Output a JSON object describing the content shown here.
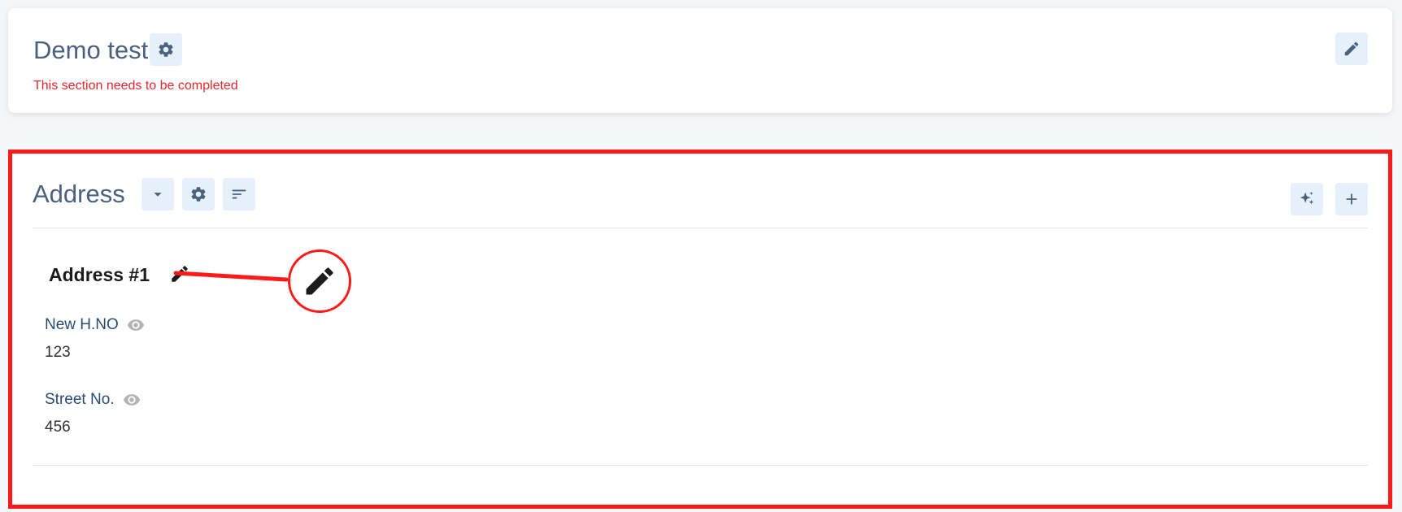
{
  "top_card": {
    "title": "Demo test",
    "message": "This section needs to be completed",
    "icons": {
      "settings": "gear-icon",
      "edit": "pencil-icon"
    }
  },
  "address_section": {
    "title": "Address",
    "header_icons": [
      "caret-down-icon",
      "gear-icon",
      "sort-icon"
    ],
    "right_icons": [
      "sparkles-icon",
      "plus-icon"
    ],
    "entry": {
      "title": "Address #1",
      "fields": [
        {
          "label": "New H.NO",
          "value": "123"
        },
        {
          "label": "Street No.",
          "value": "456"
        }
      ]
    }
  },
  "colors": {
    "accent": "#4a6280",
    "icon_bg": "#e6f0fb",
    "warning": "#e8262b",
    "highlight": "#ff1a1a"
  }
}
